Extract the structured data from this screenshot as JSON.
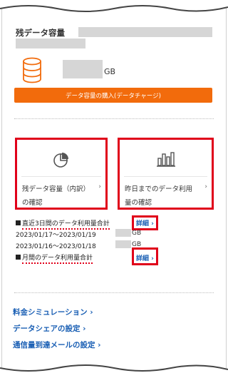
{
  "section": {
    "title": "残データ容量",
    "remaining_unit": "GB"
  },
  "buy_button": {
    "label": "データ容量の購入(データチャージ)"
  },
  "cards": [
    {
      "label_line1": "残データ容量（内訳）",
      "label_line2": "の確認",
      "chevron": "›",
      "icon": "pie-chart-icon"
    },
    {
      "label_line1": "昨日までのデータ利用",
      "label_line2": "量の確認",
      "chevron": "›",
      "icon": "bar-chart-icon"
    }
  ],
  "usage": {
    "recent_label": "直近3日間のデータ利用量合計",
    "recent_detail": "詳細 ›",
    "period1": "2023/01/17～2023/01/19",
    "period1_unit": "GB",
    "period2": "2023/01/16～2023/01/18",
    "period2_unit": "GB",
    "monthly_label": "月間のデータ利用量合計",
    "monthly_detail": "詳細 ›"
  },
  "links": [
    {
      "label": "料金シミュレーション ›"
    },
    {
      "label": "データシェアの設定 ›"
    },
    {
      "label": "通信量到達メールの設定 ›"
    }
  ],
  "colors": {
    "accent_orange": "#f26b0c",
    "highlight_red": "#e0001a",
    "link_blue": "#1a5fb4"
  }
}
